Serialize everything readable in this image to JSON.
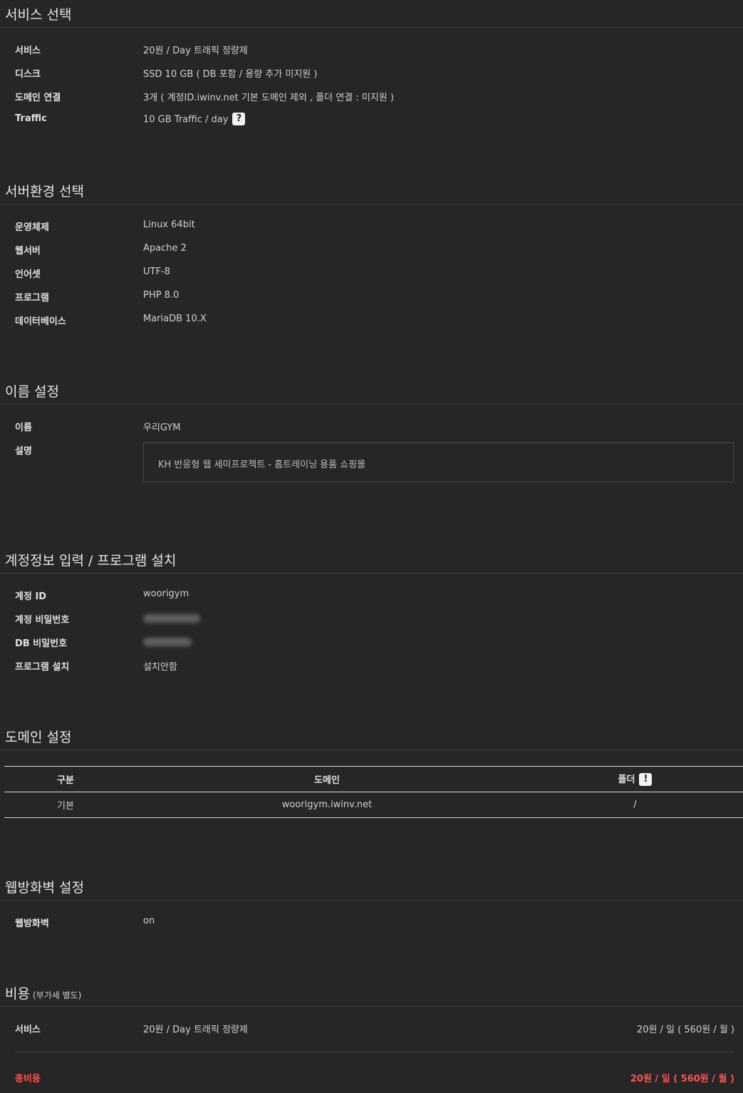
{
  "service": {
    "title": "서비스 선택",
    "rows": [
      {
        "label": "서비스",
        "value": "20원 / Day 트래픽 정량제"
      },
      {
        "label": "디스크",
        "value": "SSD 10 GB ( DB 포함 / 용량 추가 미지원 )"
      },
      {
        "label": "도메인 연결",
        "value": "3개 ( 계정ID.iwinv.net 기본 도메인 제외 , 폴더 연결 : 미지원 )"
      },
      {
        "label": "Traffic",
        "value": "10 GB Traffic / day",
        "help": "?"
      }
    ]
  },
  "server_env": {
    "title": "서버환경 선택",
    "rows": [
      {
        "label": "운영체제",
        "value": "Linux 64bit"
      },
      {
        "label": "웹서버",
        "value": "Apache 2"
      },
      {
        "label": "언어셋",
        "value": "UTF-8"
      },
      {
        "label": "프로그램",
        "value": "PHP 8.0"
      },
      {
        "label": "데이터베이스",
        "value": "MariaDB 10.X"
      }
    ]
  },
  "name_settings": {
    "title": "이름 설정",
    "name_label": "이름",
    "name_value": "우리GYM",
    "desc_label": "설명",
    "desc_value": "KH 반응형 웹 세미프로젝트 - 홈트레이닝 용품 쇼핑몰"
  },
  "account": {
    "title": "계정정보 입력 / 프로그램 설치",
    "id_label": "계정 ID",
    "id_value": "woorigym",
    "pw_label": "계정 비밀번호",
    "db_pw_label": "DB 비밀번호",
    "install_label": "프로그램 설치",
    "install_value": "설치안함"
  },
  "domain": {
    "title": "도메인 설정",
    "headers": {
      "type": "구분",
      "domain": "도메인",
      "folder": "폴더",
      "folder_badge": "!"
    },
    "rows": [
      {
        "type": "기본",
        "domain": "woorigym.iwinv.net",
        "folder": "/"
      }
    ]
  },
  "firewall": {
    "title": "웹방화벽 설정",
    "label": "웹방화벽",
    "value": "on"
  },
  "cost": {
    "title": "비용",
    "subtitle": "(부가세 별도)",
    "service_label": "서비스",
    "service_value": "20원 / Day 트래픽 정량제",
    "service_price": "20원 / 일 ( 560원 / 월 )",
    "total_label": "총비용",
    "total_price": "20원 / 일 ( 560원 / 월 )"
  },
  "colors": {
    "background": "#262626",
    "total_accent": "#ff5252"
  }
}
